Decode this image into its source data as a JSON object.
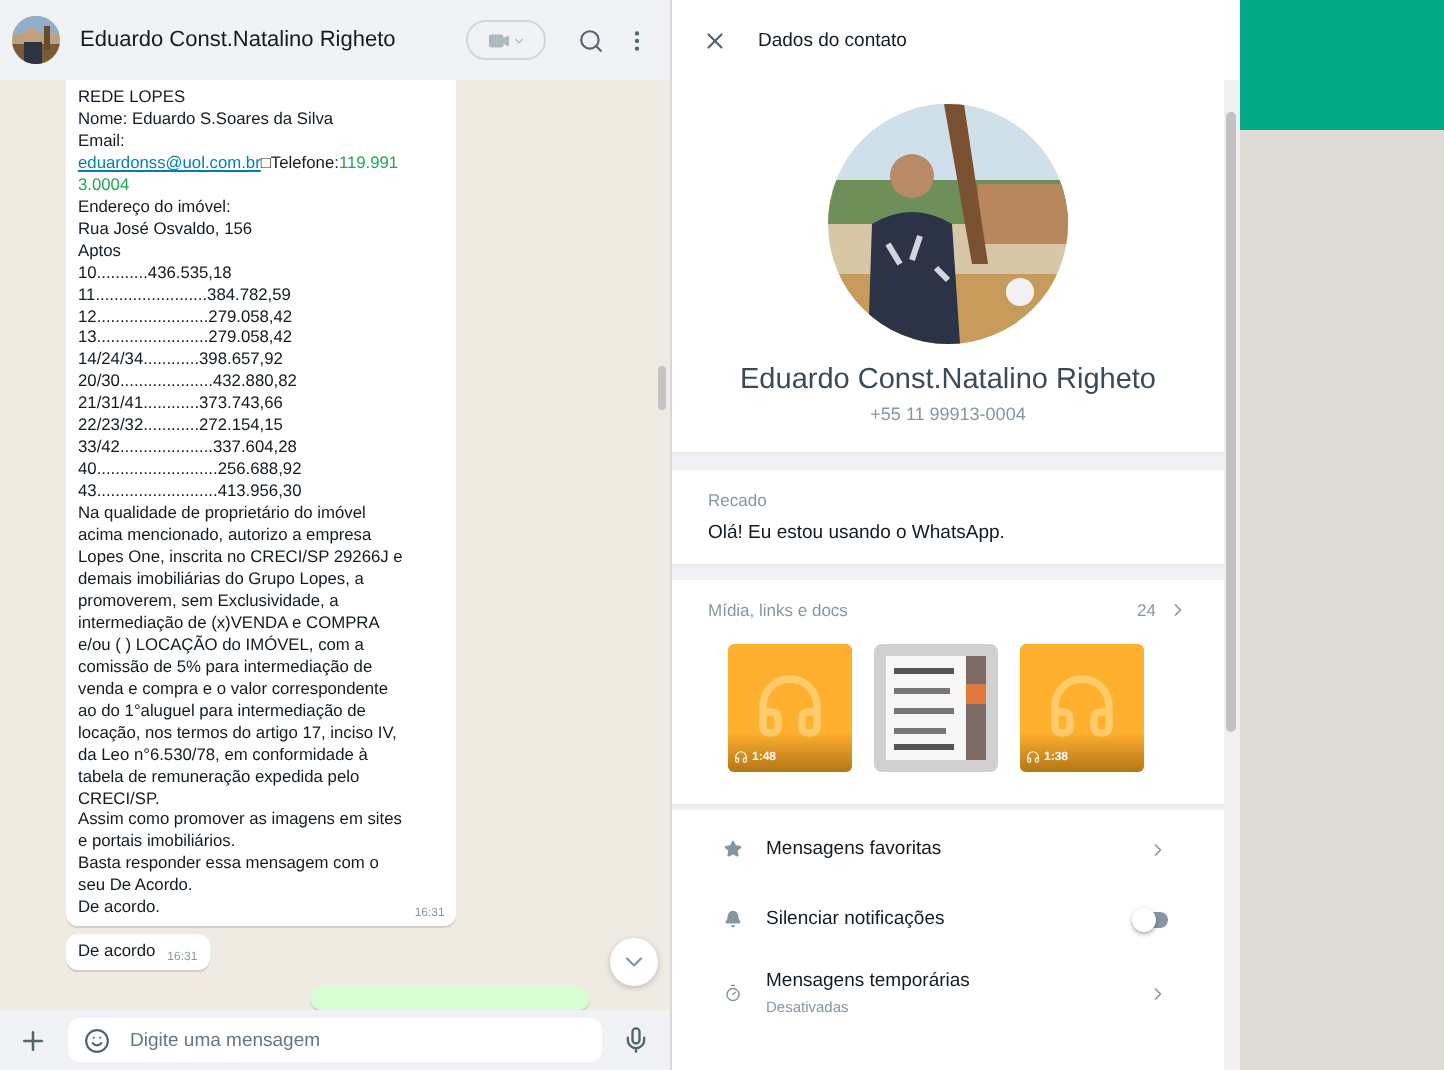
{
  "chat": {
    "contact_name": "Eduardo Const.Natalino Righeto",
    "messages": [
      {
        "kind": "incoming",
        "time": "16:31",
        "lines": [
          "REDE LOPES",
          "Nome: Eduardo S.Soares da Silva",
          "Email:",
          {
            "segments": [
              {
                "kind": "link",
                "text": "eduardonss@uol.com.br"
              },
              {
                "kind": "text",
                "text": "□Telefone:"
              },
              {
                "kind": "phone",
                "text": "119.991"
              }
            ]
          },
          {
            "segments": [
              {
                "kind": "phone",
                "text": "3.0004"
              }
            ]
          },
          "Endereço do imóvel:",
          "Rua José Osvaldo, 156",
          "Aptos",
          "10...........436.535,18",
          "11........................384.782,59",
          "12........................279.058,42",
          "13........................279.058,42",
          "14/24/34............398.657,92",
          "20/30....................432.880,82",
          "21/31/41............373.743,66",
          "22/23/32............272.154,15",
          "33/42....................337.604,28",
          "40..........................256.688,92",
          "43..........................413.956,30",
          "Na qualidade de proprietário do imóvel",
          "acima mencionado, autorizo a empresa",
          "Lopes One, inscrita no CRECI/SP 29266J e",
          "demais imobiliárias do Grupo Lopes, a",
          "promoverem, sem Exclusividade, a",
          "intermediação de (x)VENDA e COMPRA",
          "e/ou ( ) LOCAÇÃO do IMÓVEL, com a",
          "comissão de 5% para intermediação de",
          "venda e compra e o valor correspondente",
          "ao do 1°aluguel para intermediação de",
          "locação, nos termos do artigo 17, inciso IV,",
          "da Leo n°6.530/78, em conformidade à",
          "tabela de remuneração expedida pelo",
          "CRECI/SP.",
          "Assim como promover as imagens em sites",
          "e portais imobiliários.",
          "Basta responder essa mensagem com o",
          "seu De Acordo.",
          "De acordo."
        ]
      },
      {
        "kind": "incoming",
        "time": "16:31",
        "lines": [
          "De acordo"
        ]
      },
      {
        "kind": "outgoing"
      }
    ],
    "composer": {
      "placeholder": "Digite uma mensagem"
    }
  },
  "contact_panel": {
    "title": "Dados do contato",
    "name": "Eduardo Const.Natalino Righeto",
    "phone": "+55 11 99913-0004",
    "about": {
      "label": "Recado",
      "text": "Olá! Eu estou usando o WhatsApp."
    },
    "media": {
      "label": "Mídia, links e docs",
      "count": "24",
      "items": [
        {
          "kind": "audio",
          "duration": "1:48"
        },
        {
          "kind": "picture"
        },
        {
          "kind": "audio",
          "duration": "1:38"
        }
      ]
    },
    "options": [
      {
        "kind": "link",
        "label": "Mensagens favoritas"
      },
      {
        "kind": "toggle",
        "label": "Silenciar notificações",
        "on": false
      },
      {
        "kind": "link",
        "label": "Mensagens temporárias",
        "sublabel": "Desativadas"
      }
    ]
  }
}
